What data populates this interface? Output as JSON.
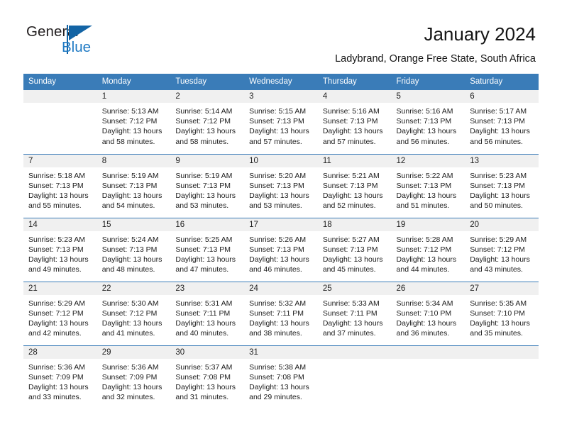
{
  "brand": {
    "name_top": "General",
    "name_bottom": "Blue",
    "accent_color": "#1364a5",
    "blue_text_color": "#1f7ac4"
  },
  "header": {
    "title": "January 2024",
    "subtitle": "Ladybrand, Orange Free State, South Africa",
    "header_bg_color": "#3a7cb8",
    "daynum_bg_color": "#f0f0f0"
  },
  "weekday_headers": [
    "Sunday",
    "Monday",
    "Tuesday",
    "Wednesday",
    "Thursday",
    "Friday",
    "Saturday"
  ],
  "weeks": [
    [
      {
        "day": "",
        "empty": true,
        "sunrise": "",
        "sunset": "",
        "daylight_1": "",
        "daylight_2": ""
      },
      {
        "day": "1",
        "empty": false,
        "sunrise": "Sunrise: 5:13 AM",
        "sunset": "Sunset: 7:12 PM",
        "daylight_1": "Daylight: 13 hours",
        "daylight_2": "and 58 minutes."
      },
      {
        "day": "2",
        "empty": false,
        "sunrise": "Sunrise: 5:14 AM",
        "sunset": "Sunset: 7:12 PM",
        "daylight_1": "Daylight: 13 hours",
        "daylight_2": "and 58 minutes."
      },
      {
        "day": "3",
        "empty": false,
        "sunrise": "Sunrise: 5:15 AM",
        "sunset": "Sunset: 7:13 PM",
        "daylight_1": "Daylight: 13 hours",
        "daylight_2": "and 57 minutes."
      },
      {
        "day": "4",
        "empty": false,
        "sunrise": "Sunrise: 5:16 AM",
        "sunset": "Sunset: 7:13 PM",
        "daylight_1": "Daylight: 13 hours",
        "daylight_2": "and 57 minutes."
      },
      {
        "day": "5",
        "empty": false,
        "sunrise": "Sunrise: 5:16 AM",
        "sunset": "Sunset: 7:13 PM",
        "daylight_1": "Daylight: 13 hours",
        "daylight_2": "and 56 minutes."
      },
      {
        "day": "6",
        "empty": false,
        "sunrise": "Sunrise: 5:17 AM",
        "sunset": "Sunset: 7:13 PM",
        "daylight_1": "Daylight: 13 hours",
        "daylight_2": "and 56 minutes."
      }
    ],
    [
      {
        "day": "7",
        "empty": false,
        "sunrise": "Sunrise: 5:18 AM",
        "sunset": "Sunset: 7:13 PM",
        "daylight_1": "Daylight: 13 hours",
        "daylight_2": "and 55 minutes."
      },
      {
        "day": "8",
        "empty": false,
        "sunrise": "Sunrise: 5:19 AM",
        "sunset": "Sunset: 7:13 PM",
        "daylight_1": "Daylight: 13 hours",
        "daylight_2": "and 54 minutes."
      },
      {
        "day": "9",
        "empty": false,
        "sunrise": "Sunrise: 5:19 AM",
        "sunset": "Sunset: 7:13 PM",
        "daylight_1": "Daylight: 13 hours",
        "daylight_2": "and 53 minutes."
      },
      {
        "day": "10",
        "empty": false,
        "sunrise": "Sunrise: 5:20 AM",
        "sunset": "Sunset: 7:13 PM",
        "daylight_1": "Daylight: 13 hours",
        "daylight_2": "and 53 minutes."
      },
      {
        "day": "11",
        "empty": false,
        "sunrise": "Sunrise: 5:21 AM",
        "sunset": "Sunset: 7:13 PM",
        "daylight_1": "Daylight: 13 hours",
        "daylight_2": "and 52 minutes."
      },
      {
        "day": "12",
        "empty": false,
        "sunrise": "Sunrise: 5:22 AM",
        "sunset": "Sunset: 7:13 PM",
        "daylight_1": "Daylight: 13 hours",
        "daylight_2": "and 51 minutes."
      },
      {
        "day": "13",
        "empty": false,
        "sunrise": "Sunrise: 5:23 AM",
        "sunset": "Sunset: 7:13 PM",
        "daylight_1": "Daylight: 13 hours",
        "daylight_2": "and 50 minutes."
      }
    ],
    [
      {
        "day": "14",
        "empty": false,
        "sunrise": "Sunrise: 5:23 AM",
        "sunset": "Sunset: 7:13 PM",
        "daylight_1": "Daylight: 13 hours",
        "daylight_2": "and 49 minutes."
      },
      {
        "day": "15",
        "empty": false,
        "sunrise": "Sunrise: 5:24 AM",
        "sunset": "Sunset: 7:13 PM",
        "daylight_1": "Daylight: 13 hours",
        "daylight_2": "and 48 minutes."
      },
      {
        "day": "16",
        "empty": false,
        "sunrise": "Sunrise: 5:25 AM",
        "sunset": "Sunset: 7:13 PM",
        "daylight_1": "Daylight: 13 hours",
        "daylight_2": "and 47 minutes."
      },
      {
        "day": "17",
        "empty": false,
        "sunrise": "Sunrise: 5:26 AM",
        "sunset": "Sunset: 7:13 PM",
        "daylight_1": "Daylight: 13 hours",
        "daylight_2": "and 46 minutes."
      },
      {
        "day": "18",
        "empty": false,
        "sunrise": "Sunrise: 5:27 AM",
        "sunset": "Sunset: 7:13 PM",
        "daylight_1": "Daylight: 13 hours",
        "daylight_2": "and 45 minutes."
      },
      {
        "day": "19",
        "empty": false,
        "sunrise": "Sunrise: 5:28 AM",
        "sunset": "Sunset: 7:12 PM",
        "daylight_1": "Daylight: 13 hours",
        "daylight_2": "and 44 minutes."
      },
      {
        "day": "20",
        "empty": false,
        "sunrise": "Sunrise: 5:29 AM",
        "sunset": "Sunset: 7:12 PM",
        "daylight_1": "Daylight: 13 hours",
        "daylight_2": "and 43 minutes."
      }
    ],
    [
      {
        "day": "21",
        "empty": false,
        "sunrise": "Sunrise: 5:29 AM",
        "sunset": "Sunset: 7:12 PM",
        "daylight_1": "Daylight: 13 hours",
        "daylight_2": "and 42 minutes."
      },
      {
        "day": "22",
        "empty": false,
        "sunrise": "Sunrise: 5:30 AM",
        "sunset": "Sunset: 7:12 PM",
        "daylight_1": "Daylight: 13 hours",
        "daylight_2": "and 41 minutes."
      },
      {
        "day": "23",
        "empty": false,
        "sunrise": "Sunrise: 5:31 AM",
        "sunset": "Sunset: 7:11 PM",
        "daylight_1": "Daylight: 13 hours",
        "daylight_2": "and 40 minutes."
      },
      {
        "day": "24",
        "empty": false,
        "sunrise": "Sunrise: 5:32 AM",
        "sunset": "Sunset: 7:11 PM",
        "daylight_1": "Daylight: 13 hours",
        "daylight_2": "and 38 minutes."
      },
      {
        "day": "25",
        "empty": false,
        "sunrise": "Sunrise: 5:33 AM",
        "sunset": "Sunset: 7:11 PM",
        "daylight_1": "Daylight: 13 hours",
        "daylight_2": "and 37 minutes."
      },
      {
        "day": "26",
        "empty": false,
        "sunrise": "Sunrise: 5:34 AM",
        "sunset": "Sunset: 7:10 PM",
        "daylight_1": "Daylight: 13 hours",
        "daylight_2": "and 36 minutes."
      },
      {
        "day": "27",
        "empty": false,
        "sunrise": "Sunrise: 5:35 AM",
        "sunset": "Sunset: 7:10 PM",
        "daylight_1": "Daylight: 13 hours",
        "daylight_2": "and 35 minutes."
      }
    ],
    [
      {
        "day": "28",
        "empty": false,
        "sunrise": "Sunrise: 5:36 AM",
        "sunset": "Sunset: 7:09 PM",
        "daylight_1": "Daylight: 13 hours",
        "daylight_2": "and 33 minutes."
      },
      {
        "day": "29",
        "empty": false,
        "sunrise": "Sunrise: 5:36 AM",
        "sunset": "Sunset: 7:09 PM",
        "daylight_1": "Daylight: 13 hours",
        "daylight_2": "and 32 minutes."
      },
      {
        "day": "30",
        "empty": false,
        "sunrise": "Sunrise: 5:37 AM",
        "sunset": "Sunset: 7:08 PM",
        "daylight_1": "Daylight: 13 hours",
        "daylight_2": "and 31 minutes."
      },
      {
        "day": "31",
        "empty": false,
        "sunrise": "Sunrise: 5:38 AM",
        "sunset": "Sunset: 7:08 PM",
        "daylight_1": "Daylight: 13 hours",
        "daylight_2": "and 29 minutes."
      },
      {
        "day": "",
        "empty": true,
        "sunrise": "",
        "sunset": "",
        "daylight_1": "",
        "daylight_2": ""
      },
      {
        "day": "",
        "empty": true,
        "sunrise": "",
        "sunset": "",
        "daylight_1": "",
        "daylight_2": ""
      },
      {
        "day": "",
        "empty": true,
        "sunrise": "",
        "sunset": "",
        "daylight_1": "",
        "daylight_2": ""
      }
    ]
  ]
}
